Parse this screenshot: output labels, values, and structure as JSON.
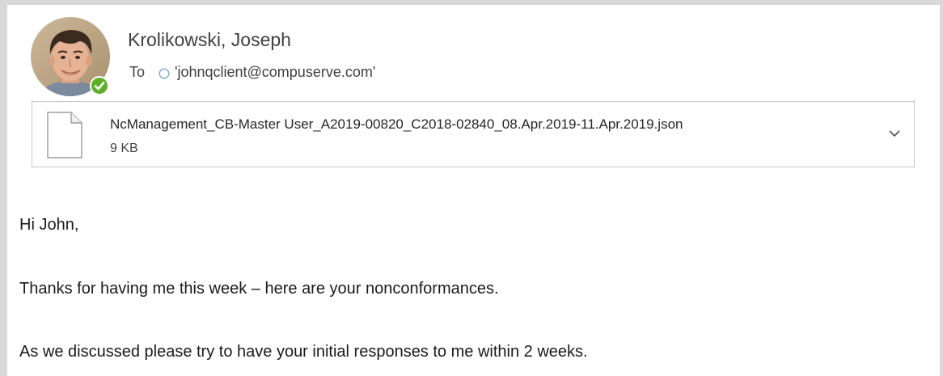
{
  "sender": {
    "name": "Krolikowski, Joseph",
    "presence": "available",
    "presence_color": "#5db025"
  },
  "recipients": {
    "to_label": "To",
    "address": "'johnqclient@compuserve.com'"
  },
  "attachment": {
    "icon": "document-icon",
    "file_name": "NcManagement_CB-Master User_A2019-00820_C2018-02840_08.Apr.2019-11.Apr.2019.json",
    "file_size": "9 KB"
  },
  "body": {
    "lines": [
      "Hi John,",
      "Thanks for having me this week – here are your nonconformances.",
      "As we discussed please try to have your initial responses to me within 2 weeks."
    ]
  }
}
